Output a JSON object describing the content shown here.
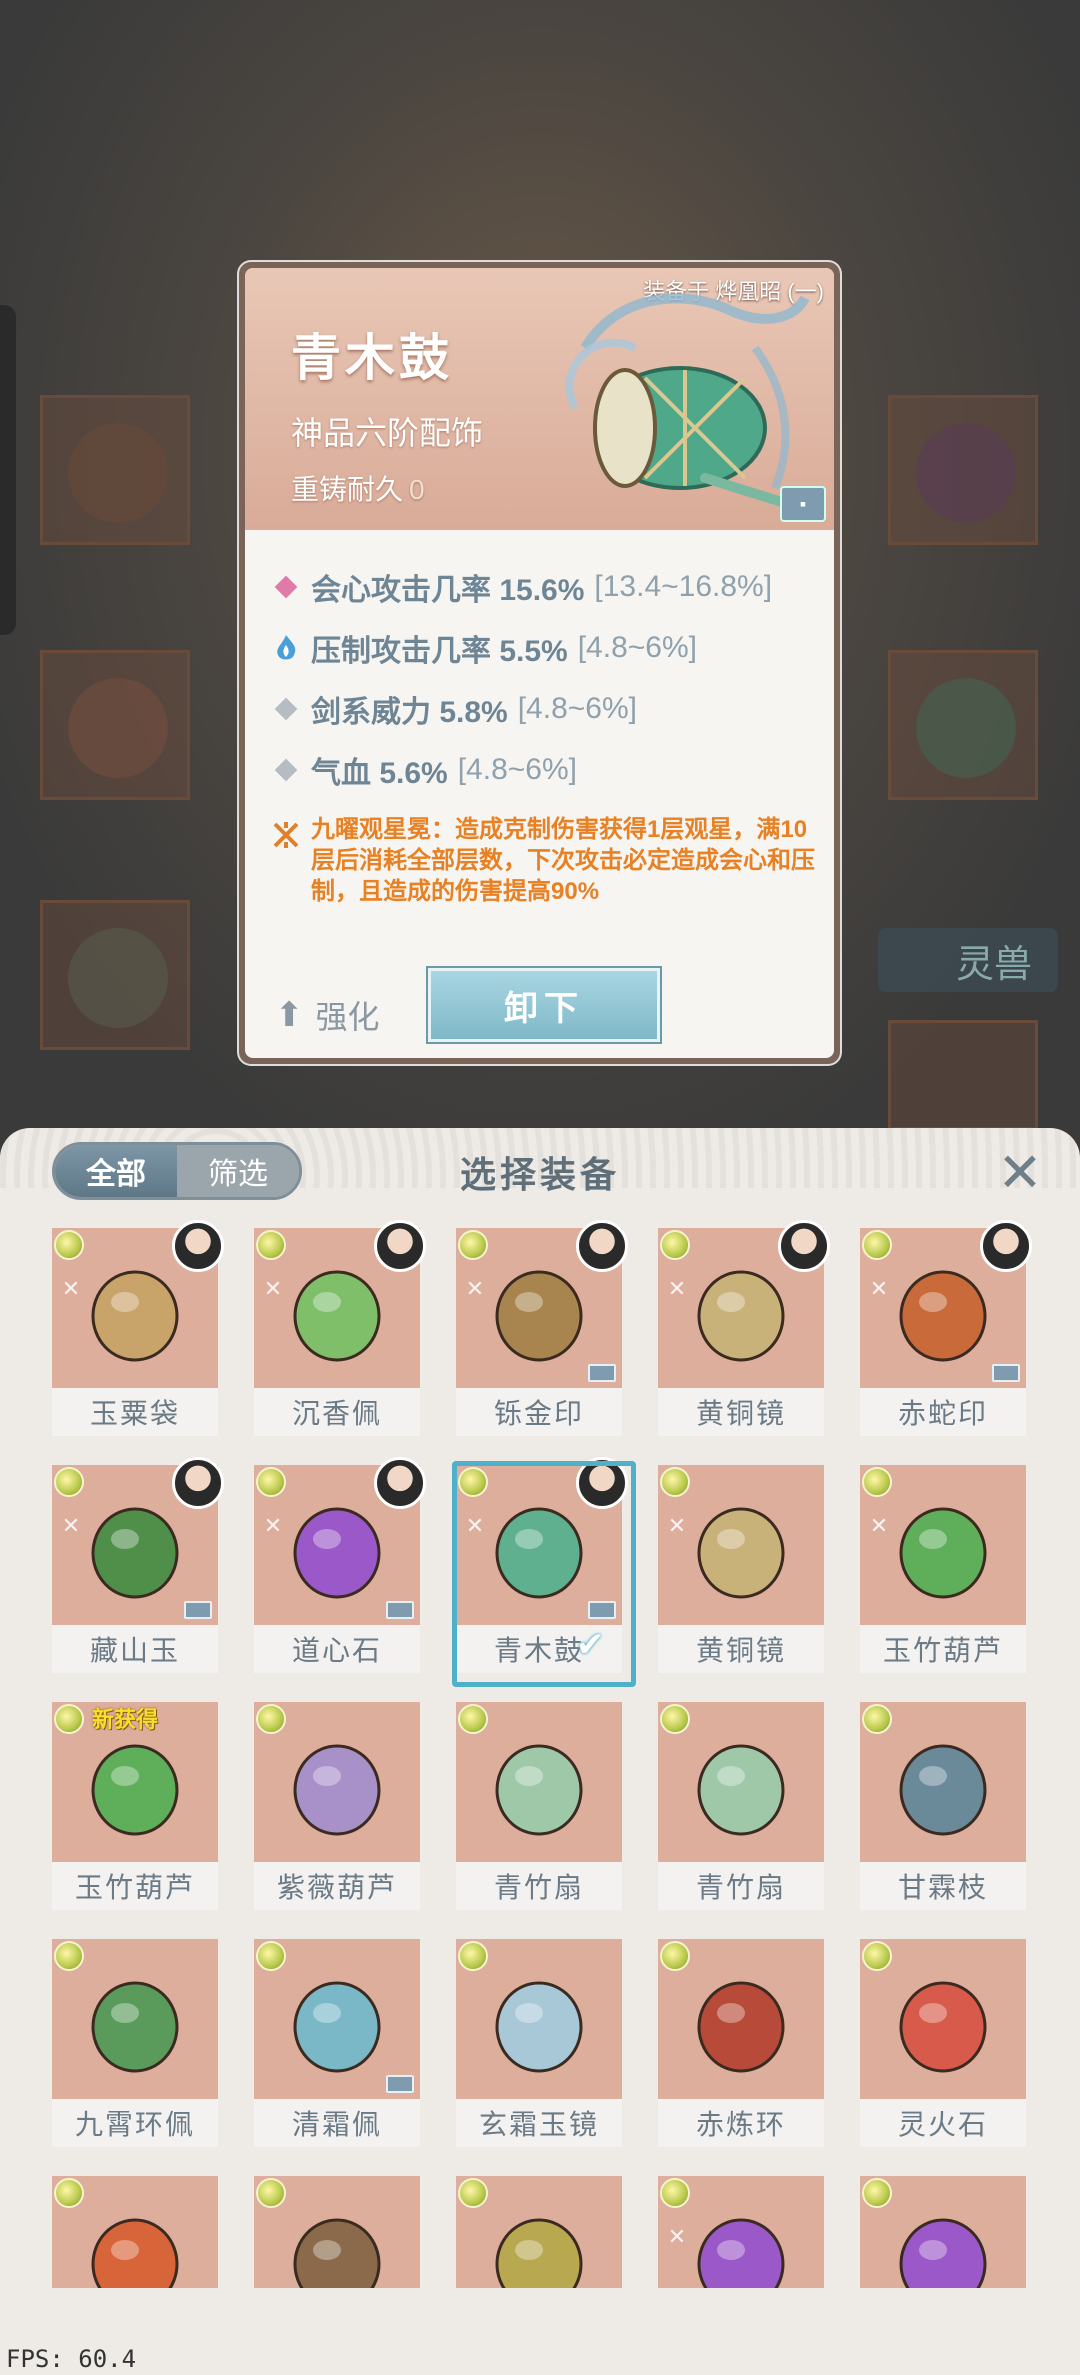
{
  "detail": {
    "equipped_on": "装备于 烨凰昭 (一)",
    "name": "青木鼓",
    "grade": "神品六阶配饰",
    "recast_label": "重铸耐久",
    "recast_value": "0",
    "stats": [
      {
        "icon": "pink-diamond-icon",
        "color": "#e07aa8",
        "label": "会心攻击几率 15.6%",
        "range": "[13.4~16.8%]"
      },
      {
        "icon": "blue-flame-icon",
        "color": "#4a9fd8",
        "label": "压制攻击几率 5.5%",
        "range": "[4.8~6%]"
      },
      {
        "icon": "gray-diamond-icon",
        "color": "#b5bcc2",
        "label": "剑系威力 5.8%",
        "range": "[4.8~6%]"
      },
      {
        "icon": "gray-diamond-icon",
        "color": "#b5bcc2",
        "label": "气血 5.6%",
        "range": "[4.8~6%]"
      }
    ],
    "special": "九曜观星冕：造成克制伤害获得1层观星，满10层后消耗全部层数，下次攻击必定造成会心和压制，且造成的伤害提高90%",
    "enhance_label": "强化",
    "unequip_label": "卸下"
  },
  "panel": {
    "tab_all": "全部",
    "tab_filter": "筛选",
    "title": "选择装备",
    "new_tag": "新获得",
    "items": [
      {
        "name": "玉粟袋",
        "avatar": true,
        "lock": false,
        "color": "#c9a46a"
      },
      {
        "name": "沉香佩",
        "avatar": true,
        "lock": false,
        "color": "#7fbf6a"
      },
      {
        "name": "铄金印",
        "avatar": true,
        "lock": true,
        "color": "#a8844e"
      },
      {
        "name": "黄铜镜",
        "avatar": true,
        "lock": false,
        "color": "#c9b27a"
      },
      {
        "name": "赤蛇印",
        "avatar": true,
        "lock": true,
        "color": "#c86a3a"
      },
      {
        "name": "藏山玉",
        "avatar": true,
        "lock": true,
        "color": "#4f8f4a"
      },
      {
        "name": "道心石",
        "avatar": true,
        "lock": true,
        "color": "#9a58c8"
      },
      {
        "name": "青木鼓",
        "avatar": true,
        "lock": true,
        "color": "#5fb08f",
        "selected": true
      },
      {
        "name": "黄铜镜",
        "avatar": false,
        "lock": false,
        "color": "#c9b27a"
      },
      {
        "name": "玉竹葫芦",
        "avatar": false,
        "lock": false,
        "color": "#5fae5a"
      },
      {
        "name": "玉竹葫芦",
        "avatar": false,
        "lock": false,
        "color": "#5fae5a",
        "new": true
      },
      {
        "name": "紫薇葫芦",
        "avatar": false,
        "lock": false,
        "color": "#a890c8"
      },
      {
        "name": "青竹扇",
        "avatar": false,
        "lock": false,
        "color": "#9fc8a8"
      },
      {
        "name": "青竹扇",
        "avatar": false,
        "lock": false,
        "color": "#9fc8a8"
      },
      {
        "name": "甘霖枝",
        "avatar": false,
        "lock": false,
        "color": "#6a8a9a"
      },
      {
        "name": "九霄环佩",
        "avatar": false,
        "lock": false,
        "color": "#5a9a5a"
      },
      {
        "name": "清霜佩",
        "avatar": false,
        "lock": true,
        "color": "#7ab8c8"
      },
      {
        "name": "玄霜玉镜",
        "avatar": false,
        "lock": false,
        "color": "#a8c8d8"
      },
      {
        "name": "赤炼环",
        "avatar": false,
        "lock": false,
        "color": "#b84a3a"
      },
      {
        "name": "灵火石",
        "avatar": false,
        "lock": false,
        "color": "#d85a4a"
      },
      {
        "name": "",
        "avatar": false,
        "lock": false,
        "color": "#d8643a"
      },
      {
        "name": "",
        "avatar": false,
        "lock": false,
        "color": "#8a6a4a"
      },
      {
        "name": "",
        "avatar": false,
        "lock": false,
        "color": "#b8a850"
      },
      {
        "name": "",
        "avatar": false,
        "lock": false,
        "color": "#9a58c8"
      },
      {
        "name": "",
        "avatar": false,
        "lock": false,
        "color": "#9a58c8"
      }
    ]
  },
  "fps": "FPS: 60.4",
  "background": {
    "tab_label": "灵兽"
  }
}
